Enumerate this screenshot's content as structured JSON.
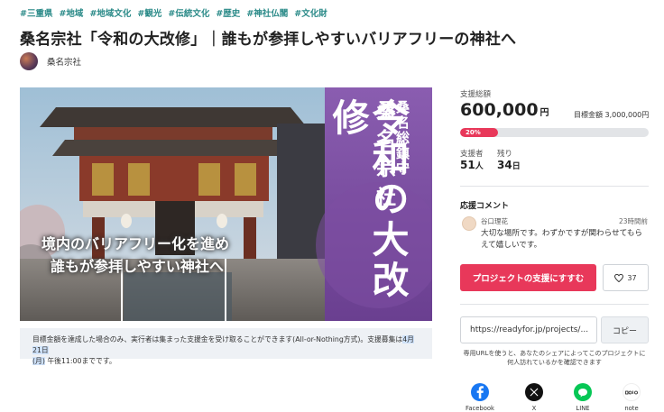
{
  "tags": [
    "#三重県",
    "#地域",
    "#地域文化",
    "#観光",
    "#伝統文化",
    "#歴史",
    "#神社仏閣",
    "#文化財"
  ],
  "title": "桑名宗社「令和の大改修」｜誰もが参拝しやすいバリアフリーの神社へ",
  "owner": {
    "name": "桑名宗社"
  },
  "hero": {
    "vertical_small": "桑名総鎮守",
    "vertical_mid": "桑名宗社",
    "vertical_big": "令和の大改修",
    "caption_line1": "境内のバリアフリー化を進め",
    "caption_line2": "誰もが参拝しやすい神社へ"
  },
  "notice": {
    "text_before": "目標金額を達成した場合のみ、実行者は集まった支援金を受け取ることができます(All-or-Nothing方式)。支援募集は",
    "highlight_date": "4月21日",
    "highlight_day": "(月)",
    "text_after": "午後11:00までです。"
  },
  "funding": {
    "total_label": "支援総額",
    "total_amount": "600,000",
    "currency": "円",
    "goal_text": "目標金額 3,000,000円",
    "progress_label": "20%",
    "progress_fraction": 0.2,
    "accent_color": "#e8385a"
  },
  "stats": {
    "supporters_label": "支援者",
    "supporters_value": "51",
    "supporters_unit": "人",
    "remaining_label": "残り",
    "remaining_value": "34",
    "remaining_unit": "日"
  },
  "comments": {
    "heading": "応援コメント",
    "items": [
      {
        "name": "谷口理花",
        "time": "23時間前",
        "text": "大切な場所です。わずかですが関わらせてもらえて嬉しいです。"
      }
    ]
  },
  "actions": {
    "support_label": "プロジェクトの支援にすすむ",
    "like_count": "37",
    "like_icon": "heart-icon"
  },
  "share": {
    "url": "https://readyfor.jp/projects/...",
    "copy_label": "コピー",
    "note": "専用URLを使うと、あなたのシェアによってこのプロジェクトに何人訪れているかを確認できます",
    "networks": [
      {
        "name": "Facebook",
        "icon": "facebook-icon",
        "color": "#1877f2"
      },
      {
        "name": "X",
        "icon": "x-icon",
        "color": "#111111"
      },
      {
        "name": "LINE",
        "icon": "line-icon",
        "color": "#06c755"
      },
      {
        "name": "note",
        "icon": "note-icon",
        "color": "#ffffff"
      }
    ]
  }
}
